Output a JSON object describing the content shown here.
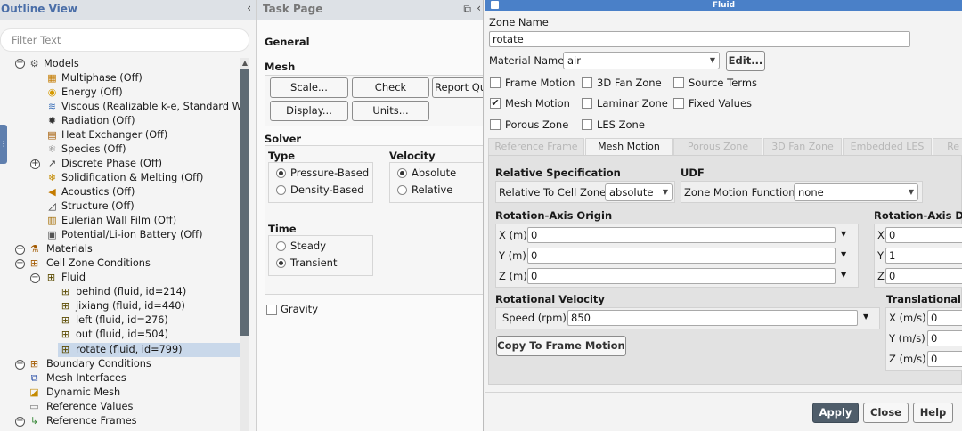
{
  "outline": {
    "title": "Outline View",
    "collapse_glyph": "‹",
    "filter_placeholder": "Filter Text",
    "items": [
      {
        "label": "Models",
        "icon": "models-icon"
      },
      {
        "label": "Multiphase (Off)",
        "icon": "multiphase-icon"
      },
      {
        "label": "Energy (Off)",
        "icon": "energy-icon"
      },
      {
        "label": "Viscous (Realizable k-e, Standard Wall Fn)",
        "icon": "viscous-icon"
      },
      {
        "label": "Radiation (Off)",
        "icon": "radiation-icon"
      },
      {
        "label": "Heat Exchanger (Off)",
        "icon": "heat-exchanger-icon"
      },
      {
        "label": "Species (Off)",
        "icon": "species-icon"
      },
      {
        "label": "Discrete Phase (Off)",
        "icon": "discrete-phase-icon"
      },
      {
        "label": "Solidification & Melting (Off)",
        "icon": "solidification-icon"
      },
      {
        "label": "Acoustics (Off)",
        "icon": "acoustics-icon"
      },
      {
        "label": "Structure (Off)",
        "icon": "structure-icon"
      },
      {
        "label": "Eulerian Wall Film (Off)",
        "icon": "wall-film-icon"
      },
      {
        "label": "Potential/Li-ion Battery (Off)",
        "icon": "battery-icon"
      },
      {
        "label": "Materials",
        "icon": "materials-icon"
      },
      {
        "label": "Cell Zone Conditions",
        "icon": "cell-zone-icon"
      },
      {
        "label": "Fluid",
        "icon": "fluid-icon"
      },
      {
        "label": "behind (fluid, id=214)",
        "icon": "zone-icon"
      },
      {
        "label": "jixiang (fluid, id=440)",
        "icon": "zone-icon"
      },
      {
        "label": "left (fluid, id=276)",
        "icon": "zone-icon"
      },
      {
        "label": "out (fluid, id=504)",
        "icon": "zone-icon"
      },
      {
        "label": "rotate (fluid, id=799)",
        "icon": "zone-icon"
      },
      {
        "label": "Boundary Conditions",
        "icon": "boundary-icon"
      },
      {
        "label": "Mesh Interfaces",
        "icon": "mesh-interface-icon"
      },
      {
        "label": "Dynamic Mesh",
        "icon": "dynamic-mesh-icon"
      },
      {
        "label": "Reference Values",
        "icon": "reference-values-icon"
      },
      {
        "label": "Reference Frames",
        "icon": "reference-frames-icon"
      }
    ]
  },
  "task": {
    "title": "Task Page",
    "general": "General",
    "mesh": "Mesh",
    "scale": "Scale...",
    "check": "Check",
    "report_quality": "Report Qu",
    "display": "Display...",
    "units": "Units...",
    "solver": "Solver",
    "type": "Type",
    "pressure_based": "Pressure-Based",
    "density_based": "Density-Based",
    "velocity_formulation": "Velocity Formula",
    "absolute": "Absolute",
    "relative": "Relative",
    "time": "Time",
    "steady": "Steady",
    "transient": "Transient",
    "gravity": "Gravity"
  },
  "fluid": {
    "window_title": "Fluid",
    "zone_name_label": "Zone Name",
    "zone_name_value": "rotate",
    "material_name_label": "Material Name",
    "material_value": "air",
    "edit": "Edit...",
    "frame_motion": "Frame Motion",
    "fan_zone": "3D Fan Zone",
    "source_terms": "Source Terms",
    "mesh_motion": "Mesh Motion",
    "laminar_zone": "Laminar Zone",
    "fixed_values": "Fixed Values",
    "porous_zone": "Porous Zone",
    "les_zone": "LES Zone",
    "tabs": [
      "Reference Frame",
      "Mesh Motion",
      "Porous Zone",
      "3D Fan Zone",
      "Embedded LES",
      "Re"
    ],
    "relative_spec": "Relative Specification",
    "relative_to_cell_zone": "Relative To Cell Zone",
    "relative_value": "absolute",
    "udf": "UDF",
    "zone_motion_function": "Zone Motion Function",
    "zone_motion_value": "none",
    "rot_axis_origin": "Rotation-Axis Origin",
    "x_m": "X (m)",
    "y_m": "Y (m)",
    "z_m": "Z (m)",
    "origin_x": "0",
    "origin_y": "0",
    "origin_z": "0",
    "rot_axis_dir": "Rotation-Axis Di",
    "dx_label": "X",
    "dy_label": "Y",
    "dz_label": "Z",
    "dir_x": "0",
    "dir_y": "1",
    "dir_z": "0",
    "rotational_velocity": "Rotational Velocity",
    "speed_label": "Speed (rpm)",
    "speed_value": "850",
    "copy_to_frame_motion": "Copy To Frame Motion",
    "translational": "Translational V",
    "tx_label": "X (m/s)",
    "ty_label": "Y (m/s)",
    "tz_label": "Z (m/s)",
    "tx": "0",
    "ty": "0",
    "tz": "0",
    "apply": "Apply",
    "close": "Close",
    "help": "Help"
  }
}
